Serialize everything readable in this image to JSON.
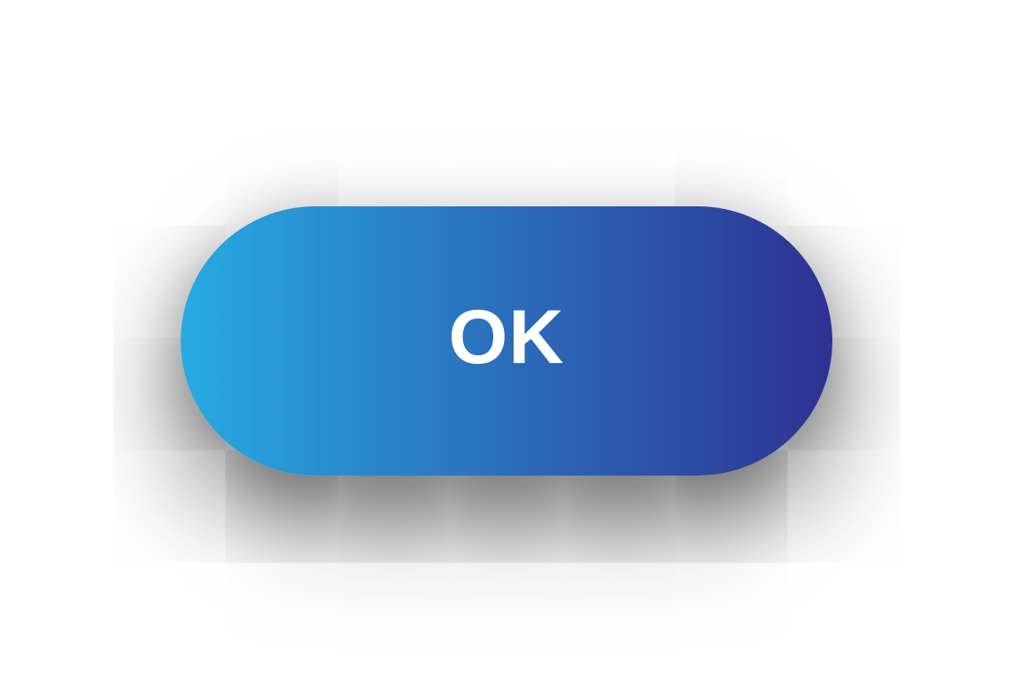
{
  "button": {
    "label": "OK",
    "gradient_start": "#27aae2",
    "gradient_end": "#2e3192",
    "text_color": "#ffffff"
  },
  "page": {
    "background": "#ffffff"
  }
}
